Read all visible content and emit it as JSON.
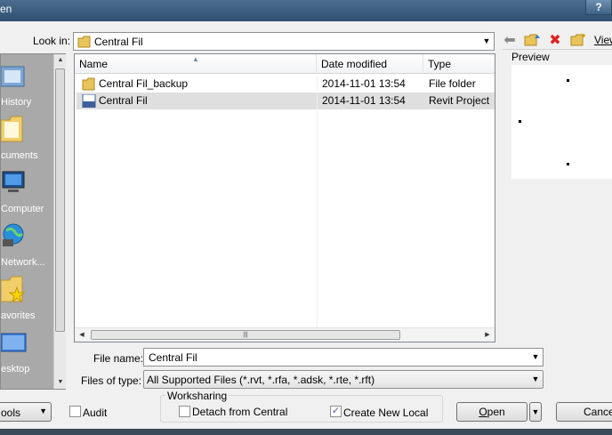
{
  "window": {
    "title": "en",
    "help_label": "?"
  },
  "lookin": {
    "label": "Look in:",
    "value": "Central Fil"
  },
  "toolbar": {
    "views_label": "View"
  },
  "places": [
    {
      "label": "History",
      "icon": "history-icon"
    },
    {
      "label": "cuments",
      "icon": "documents-folder-icon"
    },
    {
      "label": "Computer",
      "icon": "computer-icon"
    },
    {
      "label": "Network...",
      "icon": "network-icon"
    },
    {
      "label": "avorites",
      "icon": "favorites-folder-icon"
    },
    {
      "label": "esktop",
      "icon": "desktop-icon"
    }
  ],
  "filelist": {
    "columns": [
      "Name",
      "Date modified",
      "Type"
    ],
    "rows": [
      {
        "name": "Central Fil_backup",
        "date": "2014-11-01 13:54",
        "type": "File folder",
        "icon": "folder-icon"
      },
      {
        "name": "Central Fil",
        "date": "2014-11-01 13:54",
        "type": "Revit Project",
        "icon": "rvt-file-icon"
      }
    ]
  },
  "preview": {
    "label": "Preview"
  },
  "filename": {
    "label": "File name:",
    "value": "Central Fil"
  },
  "filetype": {
    "label": "Files of type:",
    "value": "All Supported Files  (*.rvt, *.rfa, *.adsk, *.rte, *.rft)"
  },
  "tools": {
    "label": "ools"
  },
  "audit": {
    "label": "Audit",
    "checked": false
  },
  "worksharing": {
    "title": "Worksharing",
    "detach_label": "Detach from Central",
    "detach_checked": false,
    "create_local_label": "Create New Local",
    "create_local_checked": true
  },
  "buttons": {
    "open_label": "pen",
    "open_mnemonic": "O",
    "cancel_label": "Cancel"
  }
}
